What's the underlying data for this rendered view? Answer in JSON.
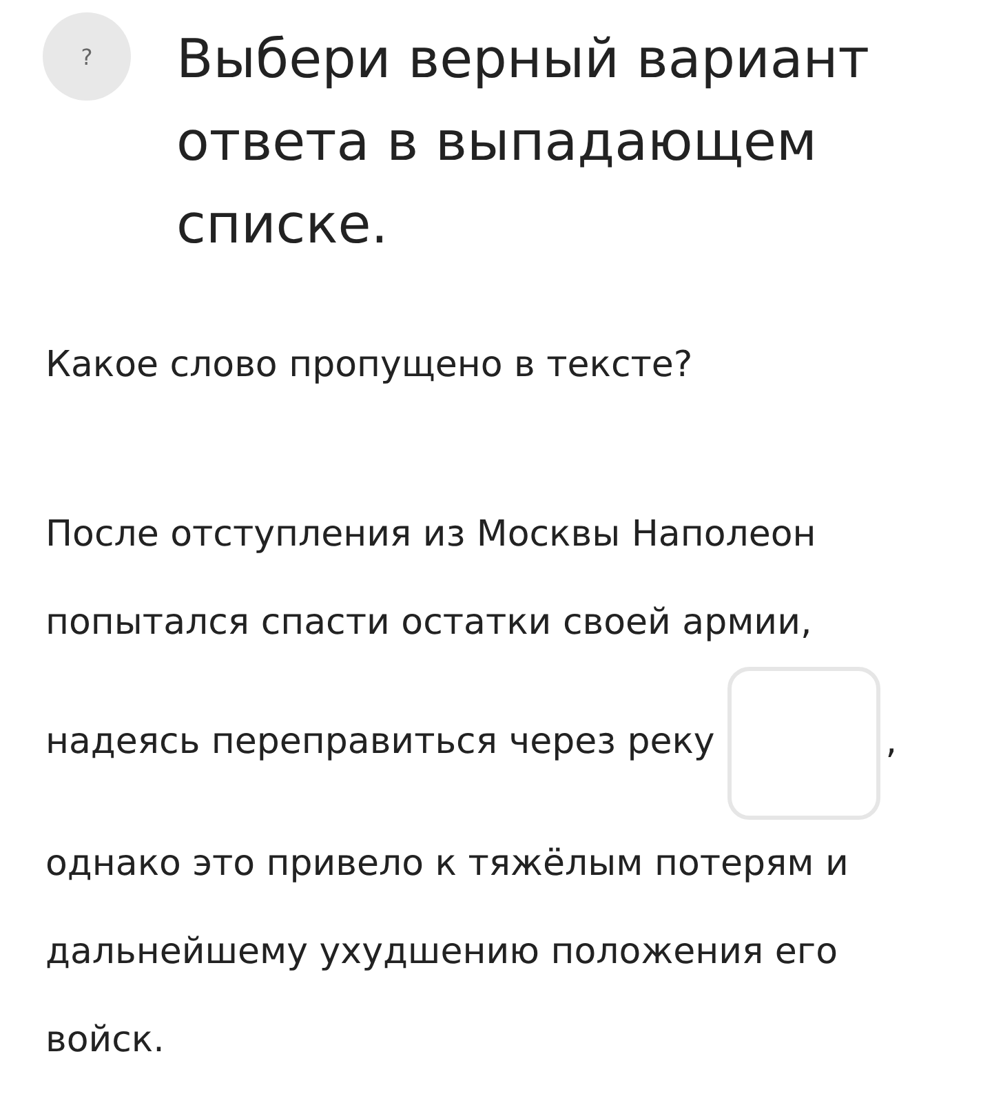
{
  "help_button": {
    "label": "?"
  },
  "title": "Выбери верный вариант ответа в выпадающем списке.",
  "question": "Какое слово пропущено в тексте?",
  "passage": [
    {
      "kind": "text",
      "text": "После отступления из Москвы Наполеон попытался спасти остатки своей армии, надеясь переправиться через реку"
    },
    {
      "kind": "dropdown"
    },
    {
      "kind": "text",
      "text": ", однако это привело к тяжёлым потерям и дальнейшему ухудшению положения его войск."
    }
  ]
}
